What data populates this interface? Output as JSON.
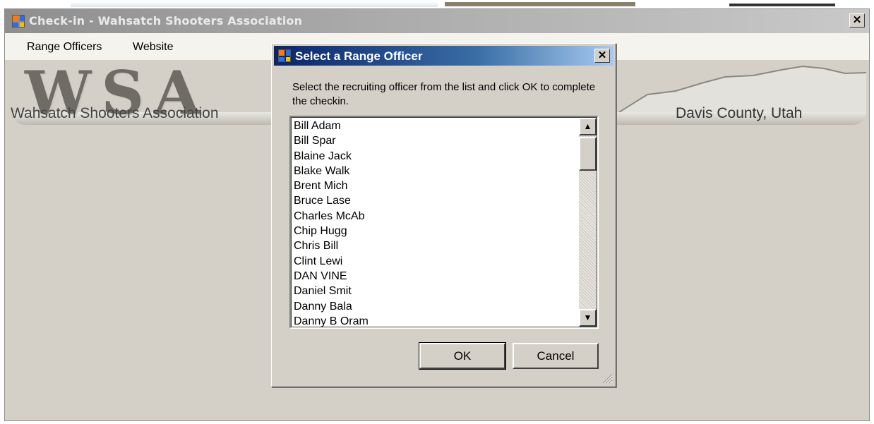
{
  "main_window": {
    "title": "Check-in - Wahsatch Shooters Association",
    "close_glyph": "✕",
    "menu": [
      "Range Officers",
      "Website"
    ],
    "banner": {
      "logo_text": "WSA",
      "org_name": "Wahsatch Shooters Association",
      "location": "Davis County, Utah"
    }
  },
  "dialog": {
    "title": "Select a Range Officer",
    "close_glyph": "✕",
    "prompt": "Select the recruiting officer from the list and click OK to complete the checkin.",
    "officers": [
      "Bill Adam",
      "Bill Spar",
      "Blaine Jack",
      "Blake Walk",
      "Brent Mich",
      "Bruce Lase",
      "Charles McAb",
      "Chip Hugg",
      "Chris Bill",
      "Clint Lewi",
      "DAN VINE",
      "Daniel Smit",
      "Danny Bala",
      "Danny B Oram"
    ],
    "ok_label": "OK",
    "cancel_label": "Cancel",
    "scroll_up_glyph": "▲",
    "scroll_down_glyph": "▼"
  },
  "colors": {
    "dialog_title_bg": "#0a246a",
    "window_bg": "#d4d0c8",
    "main_title_bg": "#a9a9a9"
  }
}
